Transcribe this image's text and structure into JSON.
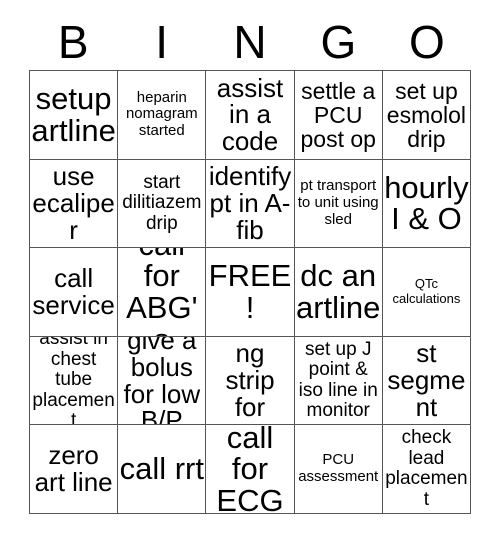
{
  "card": {
    "title": "BINGO",
    "header_letters": [
      "B",
      "I",
      "N",
      "G",
      "O"
    ],
    "colors": {
      "background": "#ffffff",
      "text": "#000000",
      "grid_line": "#555555"
    },
    "rows": [
      [
        {
          "text": "setup artline",
          "size": "xxl"
        },
        {
          "text": "heparin nomagram started",
          "size": "sm"
        },
        {
          "text": "assist in a code",
          "size": "xl"
        },
        {
          "text": "settle a PCU post op",
          "size": "lg"
        },
        {
          "text": "set up esmolol drip",
          "size": "lg"
        }
      ],
      [
        {
          "text": "use ecaliper",
          "size": "xl"
        },
        {
          "text": "start dilitiazem drip",
          "size": "md"
        },
        {
          "text": "identify pt in A-fib",
          "size": "xl"
        },
        {
          "text": "pt transport to unit using sled",
          "size": "sm"
        },
        {
          "text": "hourly I & O",
          "size": "xxl"
        }
      ],
      [
        {
          "text": "call service",
          "size": "xl"
        },
        {
          "text": "call for ABG's",
          "size": "xxl"
        },
        {
          "text": "FREE!",
          "size": "xxl"
        },
        {
          "text": "dc an artline",
          "size": "xxl"
        },
        {
          "text": "QTc calculations",
          "size": "xs"
        }
      ],
      [
        {
          "text": "assist in chest tube placement",
          "size": "md"
        },
        {
          "text": "give a bolus for low B/P",
          "size": "xl"
        },
        {
          "text": "mounting strip for ECG's",
          "size": "xl"
        },
        {
          "text": "set up J point & iso line in monitor",
          "size": "md"
        },
        {
          "text": "st segment",
          "size": "xl"
        }
      ],
      [
        {
          "text": "zero art line",
          "size": "xl"
        },
        {
          "text": "call rrt",
          "size": "xxl"
        },
        {
          "text": "call for ECG",
          "size": "xxl"
        },
        {
          "text": "PCU assessment",
          "size": "sm"
        },
        {
          "text": "check lead placement",
          "size": "md"
        }
      ]
    ]
  }
}
